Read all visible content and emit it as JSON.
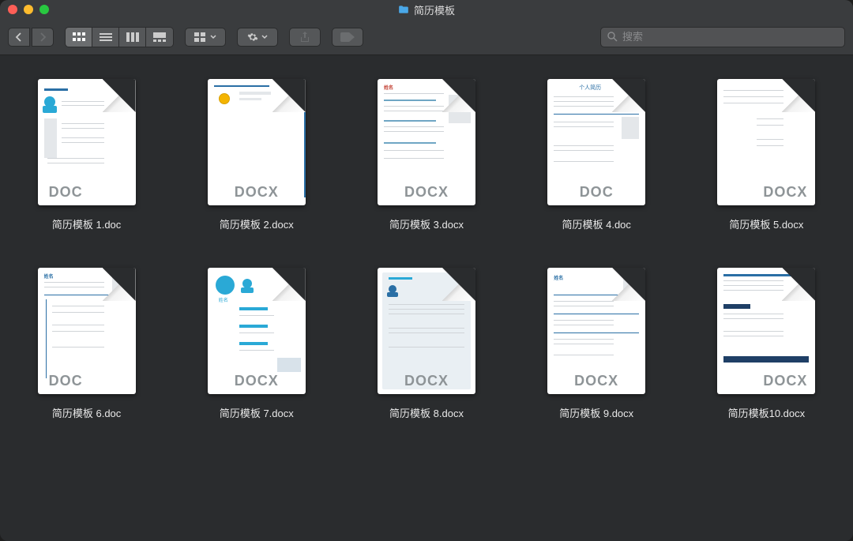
{
  "window": {
    "title": "简历模板"
  },
  "search": {
    "placeholder": "搜索"
  },
  "badges": {
    "doc": "DOC",
    "docx": "DOCX"
  },
  "files": [
    {
      "name": "简历模板 1.doc",
      "type": "doc",
      "badge_pos": "left",
      "preview": 1
    },
    {
      "name": "简历模板 2.docx",
      "type": "docx",
      "badge_pos": "center",
      "preview": 2
    },
    {
      "name": "简历模板 3.docx",
      "type": "docx",
      "badge_pos": "center",
      "preview": 3
    },
    {
      "name": "简历模板 4.doc",
      "type": "doc",
      "badge_pos": "center",
      "preview": 4
    },
    {
      "name": "简历模板 5.docx",
      "type": "docx",
      "badge_pos": "right",
      "preview": 5
    },
    {
      "name": "简历模板 6.doc",
      "type": "doc",
      "badge_pos": "left",
      "preview": 6
    },
    {
      "name": "简历模板 7.docx",
      "type": "docx",
      "badge_pos": "center",
      "preview": 7
    },
    {
      "name": "简历模板 8.docx",
      "type": "docx",
      "badge_pos": "center",
      "preview": 8
    },
    {
      "name": "简历模板 9.docx",
      "type": "docx",
      "badge_pos": "center",
      "preview": 9
    },
    {
      "name": "简历模板10.docx",
      "type": "docx",
      "badge_pos": "right",
      "preview": 10
    }
  ]
}
